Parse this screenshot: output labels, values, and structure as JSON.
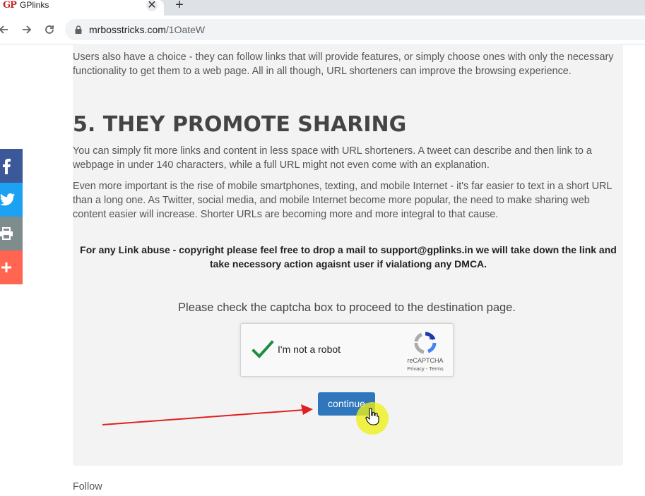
{
  "browser": {
    "tab": {
      "favicon_text": "GP",
      "title": "GPlinks",
      "close_glyph": "✕"
    },
    "new_tab_glyph": "+",
    "url_domain": "mrbosstricks.com",
    "url_path": "/1OateW",
    "icons": [
      "back-icon",
      "forward-icon",
      "reload-icon",
      "lock-icon"
    ]
  },
  "article": {
    "intro_paragraph": "Users also have a choice - they can follow links that will provide features, or simply choose ones with only the necessary functionality to get them to a web page. All in all though, URL shorteners can improve the browsing experience.",
    "heading": "5. THEY PROMOTE SHARING",
    "paragraph_1": "You can simply fit more links and content in less space with URL shorteners. A tweet can describe and then link to a webpage in under 140 characters, while a full URL might not even come with an explanation.",
    "paragraph_2": "Even more important is the rise of mobile smartphones, texting, and mobile Internet - it's far easier to text in a short URL than a long one. As Twitter, social media, and mobile Internet become more popular, the need to make sharing web content easier will increase. Shorter URLs are becoming more and more integral to that cause.",
    "abuse_notice": "For any Link abuse - copyright please feel free to drop a mail to support@gplinks.in we will take down the link and take necessory action agaisnt user if vialationg any DMCA."
  },
  "captcha": {
    "prompt": "Please check the captcha box to proceed to the destination page.",
    "label": "I'm not a robot",
    "brand": "reCAPTCHA",
    "links": "Privacy - Terms",
    "checked": true
  },
  "continue_label": "continue",
  "footer_label": "Follow",
  "share_sidebar": [
    {
      "name": "facebook",
      "icon": "facebook-icon",
      "color": "#3b5998"
    },
    {
      "name": "twitter",
      "icon": "twitter-icon",
      "color": "#1da1f2"
    },
    {
      "name": "print",
      "icon": "print-icon",
      "color": "#7f8c8d"
    },
    {
      "name": "more",
      "icon": "plus-icon",
      "color": "#ff6550"
    }
  ],
  "colors": {
    "accent_button": "#2f76bd",
    "content_bg": "#f3f3f3",
    "annotation_arrow": "#e02020",
    "cursor_highlight": "#eef014"
  }
}
